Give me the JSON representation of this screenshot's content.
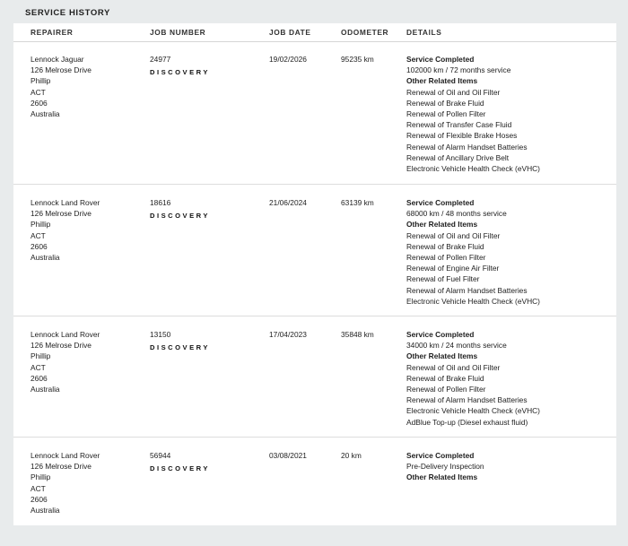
{
  "section_title": "SERVICE HISTORY",
  "columns": {
    "repairer": "REPAIRER",
    "job_number": "JOB NUMBER",
    "job_date": "JOB DATE",
    "odometer": "ODOMETER",
    "details": "DETAILS"
  },
  "records": [
    {
      "repairer": [
        "Lennock Jaguar",
        "126 Melrose Drive",
        "Phillip",
        "ACT",
        "2606",
        "Australia"
      ],
      "job_number": "24977",
      "brand": "DISCOVERY",
      "job_date": "19/02/2026",
      "odometer": "95235 km",
      "service_heading": "Service Completed",
      "service_desc": "102000 km / 72 months service",
      "other_heading": "Other Related Items",
      "items": [
        "Renewal of Oil and Oil Filter",
        "Renewal of Brake Fluid",
        "Renewal of Pollen Filter",
        "Renewal of Transfer Case Fluid",
        "Renewal of Flexible Brake Hoses",
        "Renewal of Alarm Handset Batteries",
        "Renewal of Ancillary Drive Belt",
        "Electronic Vehicle Health Check (eVHC)"
      ]
    },
    {
      "repairer": [
        "Lennock Land Rover",
        "126 Melrose Drive",
        "Phillip",
        "ACT",
        "2606",
        "Australia"
      ],
      "job_number": "18616",
      "brand": "DISCOVERY",
      "job_date": "21/06/2024",
      "odometer": "63139 km",
      "service_heading": "Service Completed",
      "service_desc": "68000 km / 48 months service",
      "other_heading": "Other Related Items",
      "items": [
        "Renewal of Oil and Oil Filter",
        "Renewal of Brake Fluid",
        "Renewal of Pollen Filter",
        "Renewal of Engine Air Filter",
        "Renewal of Fuel Filter",
        "Renewal of Alarm Handset Batteries",
        "Electronic Vehicle Health Check (eVHC)"
      ]
    },
    {
      "repairer": [
        "Lennock Land Rover",
        "126 Melrose Drive",
        "Phillip",
        "ACT",
        "2606",
        "Australia"
      ],
      "job_number": "13150",
      "brand": "DISCOVERY",
      "job_date": "17/04/2023",
      "odometer": "35848 km",
      "service_heading": "Service Completed",
      "service_desc": "34000 km / 24 months service",
      "other_heading": "Other Related Items",
      "items": [
        "Renewal of Oil and Oil Filter",
        "Renewal of Brake Fluid",
        "Renewal of Pollen Filter",
        "Renewal of Alarm Handset Batteries",
        "Electronic Vehicle Health Check (eVHC)",
        "AdBlue Top-up (Diesel exhaust fluid)"
      ]
    },
    {
      "repairer": [
        "Lennock Land Rover",
        "126 Melrose Drive",
        "Phillip",
        "ACT",
        "2606",
        "Australia"
      ],
      "job_number": "56944",
      "brand": "DISCOVERY",
      "job_date": "03/08/2021",
      "odometer": "20 km",
      "service_heading": "Service Completed",
      "service_desc": "Pre-Delivery Inspection",
      "other_heading": "Other Related Items",
      "items": []
    }
  ]
}
